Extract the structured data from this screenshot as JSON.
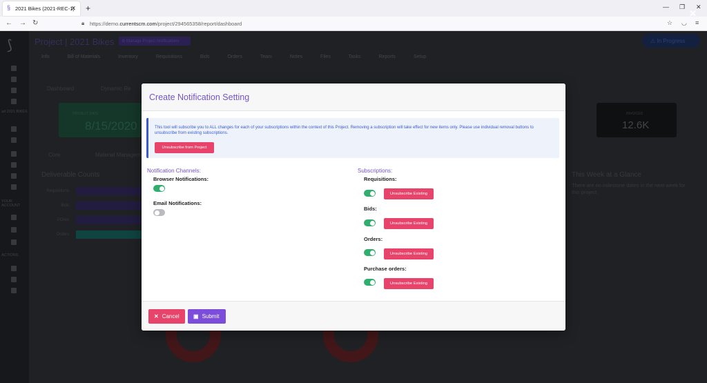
{
  "browser": {
    "tab_title": "2021 Bikes (2021-REC-1)",
    "url_prefix": "https://demo.",
    "url_domain": "currentscm.com",
    "url_path": "/project/294565358/report/dashboard"
  },
  "app": {
    "project_title": "Project | 2021 Bikes",
    "manage_label": "⚙ Manage Project Notifications",
    "status_label": "⚠ In Progress",
    "nav": [
      "Info",
      "Bill of Materials",
      "Inventory",
      "Requisitions",
      "Bids",
      "Orders",
      "Team",
      "Notes",
      "Files",
      "Tasks",
      "Reports",
      "Setup"
    ],
    "dashboard_tab": "Dashboard",
    "dynamic_tab": "Dynamic Re",
    "core_label": "Core",
    "material_label": "Material Managem",
    "project_date_label": "PROJECT DATE",
    "project_date": "8/15/2020",
    "invoiced_label": "INVOICED",
    "invoiced_value": "12.6K",
    "deliverable_title": "Deliverable Counts",
    "glance_title": "This Week at a Glance",
    "glance_text": "There are no milestone dates in the next week for this project.",
    "row_labels": [
      "Requisitions",
      "Bids",
      "POres",
      "Orders"
    ],
    "sidebar_texts": [
      "ad 2021 BIKES",
      "YOUR ACCOUNT",
      "ACTIONS"
    ]
  },
  "modal": {
    "title": "Create Notification Setting",
    "info_text": "This tool will subscribe you to ALL changes for each of your subscriptions within the context of this Project. Removing a subscription will take effect for new items only. Please use individual removal buttons to unsubscribe from existing subscriptions.",
    "unsubscribe_project_label": "Unsubscribe from Project",
    "channels_heading": "Notification Channels:",
    "browser_label": "Browser Notifications:",
    "email_label": "Email Notifications:",
    "subscriptions_heading": "Subscriptions:",
    "subscriptions": [
      {
        "label": "Requisitions:",
        "button": "Unsubscribe Existing"
      },
      {
        "label": "Bids:",
        "button": "Unsubscribe Existing"
      },
      {
        "label": "Orders:",
        "button": "Unsubscribe Existing"
      },
      {
        "label": "Purchase orders:",
        "button": "Unsubscribe Existing"
      }
    ],
    "cancel_label": "Cancel",
    "submit_label": "Submit"
  }
}
